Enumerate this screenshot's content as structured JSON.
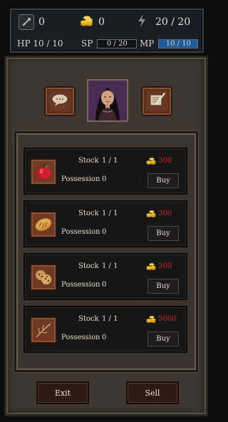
{
  "top": {
    "gold_a": "0",
    "gold_b": "0",
    "energy": "20 / 20",
    "hp": "HP 10 / 10",
    "sp_label": "SP",
    "sp_value": "0 / 20",
    "sp_fill": 0,
    "mp_label": "MP",
    "mp_value": "10 / 10",
    "mp_fill": 1.0
  },
  "shop": {
    "stock_label": "Stock",
    "possession_label": "Possession",
    "buy_label": "Buy",
    "items": [
      {
        "name": "apple",
        "stock": "1 / 1",
        "possession": "0",
        "price": "300"
      },
      {
        "name": "bread",
        "stock": "1 / 1",
        "possession": "0",
        "price": "300"
      },
      {
        "name": "cookie",
        "stock": "1 / 1",
        "possession": "0",
        "price": "300"
      },
      {
        "name": "herb",
        "stock": "1 / 1",
        "possession": "0",
        "price": "5000"
      }
    ]
  },
  "buttons": {
    "exit": "Exit",
    "sell": "Sell"
  },
  "colors": {
    "price": "#d02a22",
    "mp_fill": "#1f5b9a"
  }
}
